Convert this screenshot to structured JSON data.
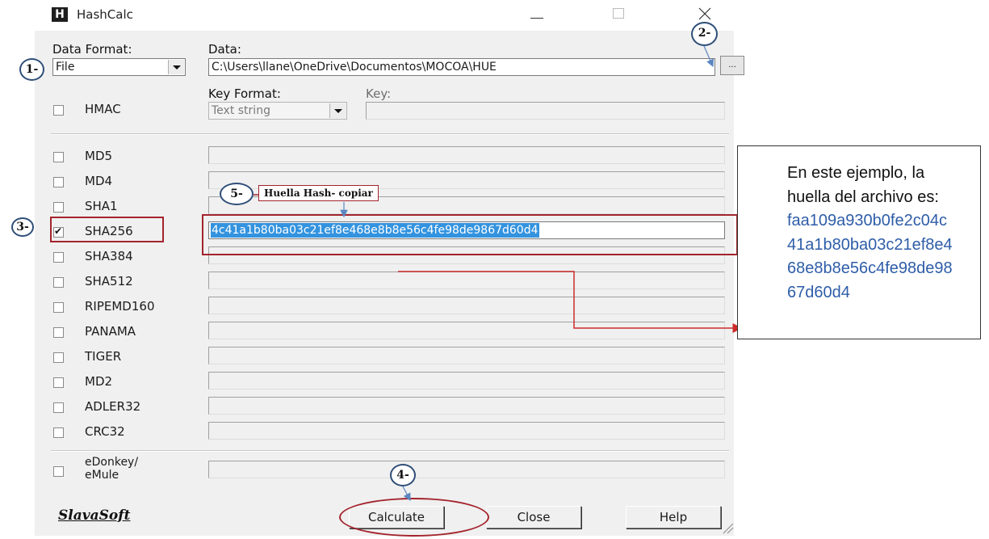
{
  "window": {
    "title": "HashCalc",
    "app_icon_letter": "H"
  },
  "input": {
    "data_format_label": "Data Format:",
    "data_format_value": "File",
    "data_label": "Data:",
    "data_value": "C:\\Users\\llane\\OneDrive\\Documentos\\MOCOA\\HUE",
    "browse_label": "..."
  },
  "hmac": {
    "label": "HMAC",
    "key_format_label": "Key Format:",
    "key_format_value": "Text string",
    "key_label": "Key:",
    "key_value": ""
  },
  "algorithms": [
    {
      "label": "MD5",
      "checked": false,
      "value": ""
    },
    {
      "label": "MD4",
      "checked": false,
      "value": ""
    },
    {
      "label": "SHA1",
      "checked": false,
      "value": ""
    },
    {
      "label": "SHA256",
      "checked": true,
      "value": "4c41a1b80ba03c21ef8e468e8b8e56c4fe98de9867d60d4"
    },
    {
      "label": "SHA384",
      "checked": false,
      "value": ""
    },
    {
      "label": "SHA512",
      "checked": false,
      "value": ""
    },
    {
      "label": "RIPEMD160",
      "checked": false,
      "value": ""
    },
    {
      "label": "PANAMA",
      "checked": false,
      "value": ""
    },
    {
      "label": "TIGER",
      "checked": false,
      "value": ""
    },
    {
      "label": "MD2",
      "checked": false,
      "value": ""
    },
    {
      "label": "ADLER32",
      "checked": false,
      "value": ""
    },
    {
      "label": "CRC32",
      "checked": false,
      "value": ""
    },
    {
      "label_line1": "eDonkey/",
      "label_line2": "eMule",
      "checked": false,
      "value": ""
    }
  ],
  "footer": {
    "logo": "SlavaSoft",
    "calculate_label": "Calculate",
    "close_label": "Close",
    "help_label": "Help"
  },
  "annotations": {
    "step1": "1-",
    "step2": "2-",
    "step3": "3-",
    "step4": "4-",
    "step5": "5-",
    "callout_text": "Huella Hash- copiar",
    "info_line1": "En este ejemplo, la",
    "info_line2": "huella del archivo es:",
    "hash_line1": "faa109a930b0fe2c04c",
    "hash_line2": "41a1b80ba03c21ef8e4",
    "hash_line3": "68e8b8e56c4fe98de98",
    "hash_line4": "67d60d4"
  },
  "colors": {
    "annotation_red": "#a3242c",
    "annotation_blue": "#2f4e78",
    "selection_blue": "#3393df",
    "hash_text_blue": "#2e5da8"
  }
}
